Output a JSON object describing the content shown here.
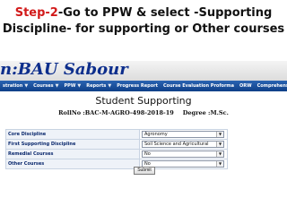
{
  "caption": {
    "step": "Step-2",
    "line1_rest": "-Go to PPW & select -Supporting",
    "line2": "Discipline- for supporting or Other courses"
  },
  "app": {
    "title": "n:BAU Sabour"
  },
  "nav": {
    "items": [
      {
        "label": "stration",
        "dropdown": true
      },
      {
        "label": "Courses",
        "dropdown": true
      },
      {
        "label": "PPW",
        "dropdown": true
      },
      {
        "label": "Reports",
        "dropdown": true
      },
      {
        "label": "Progress Report",
        "dropdown": false
      },
      {
        "label": "Course Evaluation Proforma",
        "dropdown": false
      },
      {
        "label": "ORW",
        "dropdown": false
      },
      {
        "label": "Comprehensive",
        "dropdown": false
      }
    ]
  },
  "page": {
    "title": "Student Supporting",
    "roll_label": "RollNo :",
    "roll_value": "BAC-M-AGRO-498-2018-19",
    "degree_label": "Degree :",
    "degree_value": "M.Sc."
  },
  "form": {
    "rows": [
      {
        "label": "Core Discipline",
        "value": "Agronomy"
      },
      {
        "label": "First Supporting Discipline",
        "value": "Soil Science and Agricultural"
      },
      {
        "label": "Remedial Courses",
        "value": "No"
      },
      {
        "label": "Other Courses",
        "value": "No"
      }
    ],
    "submit_label": "Submit"
  },
  "colors": {
    "step_red": "#d21a1a",
    "nav_blue": "#1a4f9c",
    "brand_blue": "#0d2e8c",
    "label_blue": "#0c2a6e"
  }
}
